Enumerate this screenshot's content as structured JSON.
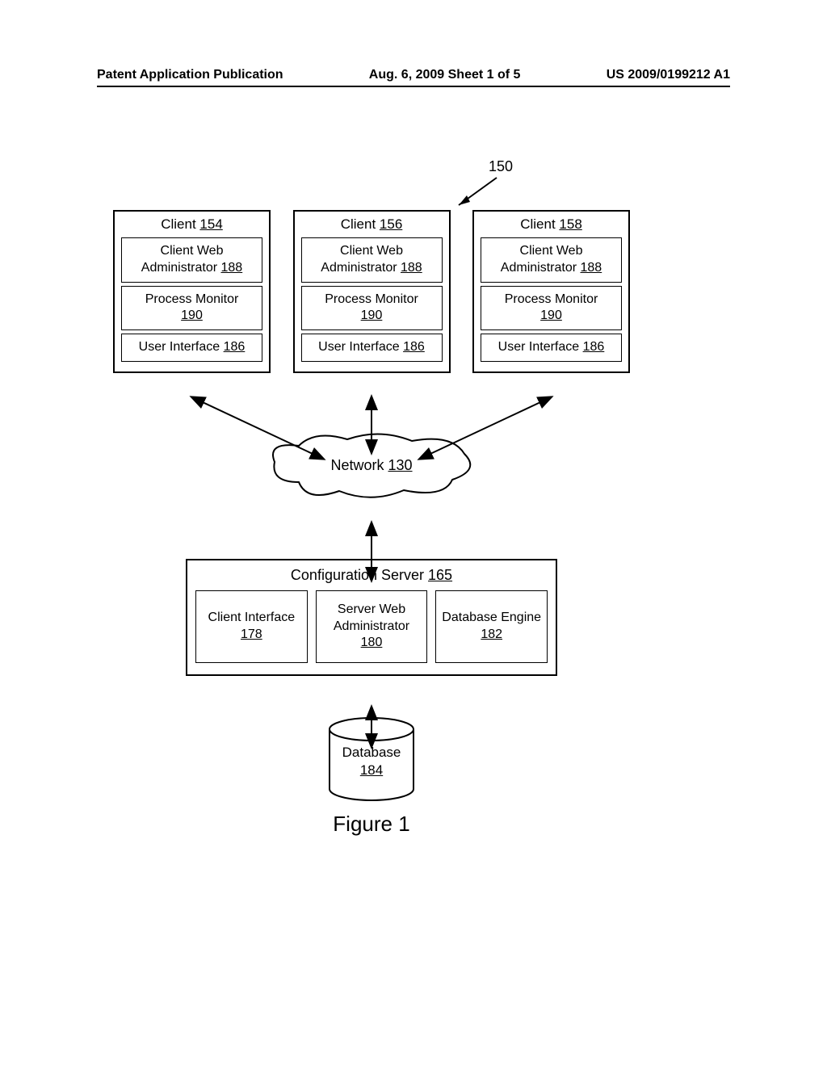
{
  "header": {
    "left": "Patent Application Publication",
    "mid": "Aug. 6, 2009  Sheet 1 of 5",
    "right": "US 2009/0199212 A1"
  },
  "ref150": "150",
  "clients": [
    {
      "title": "Client ",
      "ref": "154"
    },
    {
      "title": "Client ",
      "ref": "156"
    },
    {
      "title": "Client ",
      "ref": "158"
    }
  ],
  "client_subs": {
    "web_admin": {
      "label": "Client Web Administrator ",
      "ref": "188"
    },
    "process_monitor": {
      "label": "Process Monitor",
      "ref": "190"
    },
    "user_interface": {
      "label": "User Interface ",
      "ref": "186"
    }
  },
  "network": {
    "label": "Network ",
    "ref": "130"
  },
  "server": {
    "title": "Configuration Server ",
    "ref": "165",
    "subs": {
      "client_interface": {
        "label": "Client Interface",
        "ref": "178"
      },
      "server_web_admin": {
        "label": "Server Web Administrator",
        "ref": "180"
      },
      "db_engine": {
        "label": "Database Engine ",
        "ref": "182"
      }
    }
  },
  "database": {
    "label": "Database",
    "ref": "184"
  },
  "figure_title": "Figure 1"
}
